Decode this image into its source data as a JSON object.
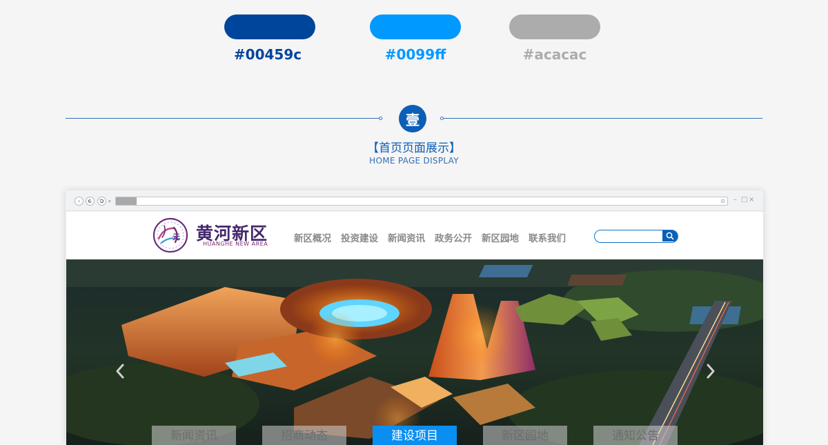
{
  "palette": [
    {
      "hex": "#00459c",
      "label": "#00459c"
    },
    {
      "hex": "#0099ff",
      "label": "#0099ff"
    },
    {
      "hex": "#acacac",
      "label": "#acacac"
    }
  ],
  "section": {
    "badge": "壹",
    "title": "【首页页面展示】",
    "subtitle": "HOME PAGE DISPLAY"
  },
  "browser": {
    "back_icon": "‹",
    "forward_icon": "‹",
    "refresh_icon": "↻",
    "window_controls": [
      "–",
      "□",
      "×"
    ]
  },
  "site": {
    "logo_cn": "黄河新区",
    "logo_en": "HUANGHE  NEW AREA",
    "nav": [
      "新区概况",
      "投资建设",
      "新闻资讯",
      "政务公开",
      "新区园地",
      "联系我们"
    ],
    "search_placeholder": ""
  },
  "banner": {
    "tabs": [
      "新闻资讯",
      "招商动态",
      "建设项目",
      "新区园地",
      "通知公告"
    ],
    "active_tab": 2
  },
  "colors": {
    "brand_dark": "#00459c",
    "brand_light": "#0099ff",
    "gray": "#acacac"
  }
}
